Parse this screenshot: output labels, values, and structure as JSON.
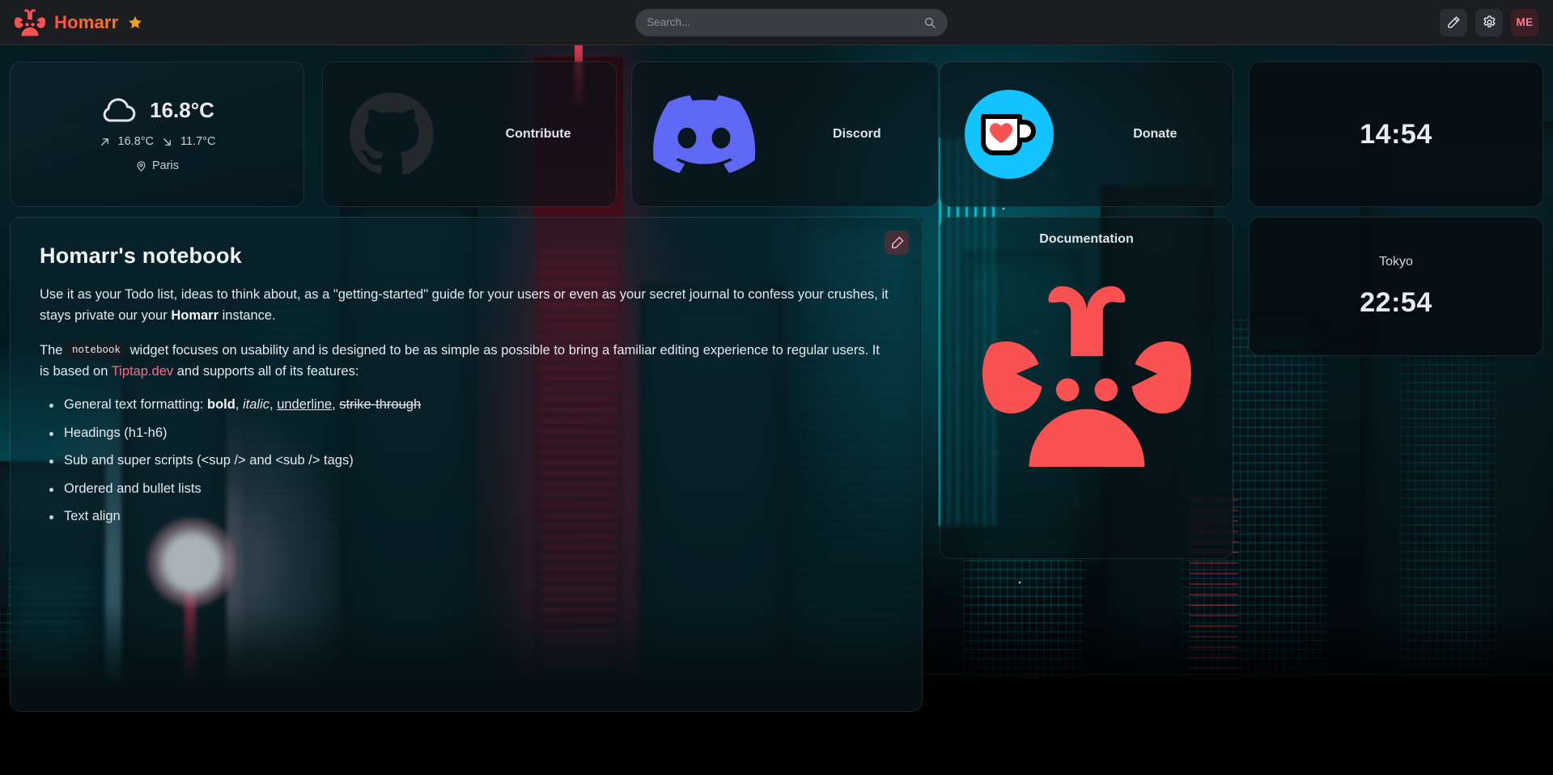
{
  "header": {
    "brand_name": "Homarr",
    "brand_logo_icon": "homarr-crab-logo",
    "brand_star_icon": "star-icon",
    "search": {
      "placeholder": "Search...",
      "value": "",
      "icon": "search-icon"
    },
    "edit_button_icon": "edit-pencil-icon",
    "settings_button_icon": "gear-icon",
    "avatar_initials": "ME"
  },
  "weather": {
    "condition_icon": "cloud-icon",
    "temperature": "16.8°C",
    "max_icon": "arrow-up-right-icon",
    "max_temp": "16.8°C",
    "min_icon": "arrow-down-right-icon",
    "min_temp": "11.7°C",
    "location_icon": "map-pin-icon",
    "location": "Paris"
  },
  "tiles": [
    {
      "id": "contribute",
      "label": "Contribute",
      "icon": "github-icon"
    },
    {
      "id": "discord",
      "label": "Discord",
      "icon": "discord-icon"
    },
    {
      "id": "donate",
      "label": "Donate",
      "icon": "kofi-cup-heart-icon"
    },
    {
      "id": "docs",
      "label": "Documentation",
      "icon": "homarr-crab-logo"
    }
  ],
  "clocks": [
    {
      "id": "local",
      "city": "",
      "time": "14:54"
    },
    {
      "id": "tokyo",
      "city": "Tokyo",
      "time": "22:54"
    }
  ],
  "notebook": {
    "title": "Homarr's notebook",
    "edit_icon": "edit-square-pencil-icon",
    "p1_a": "Use it as your Todo list, ideas to think about, as a \"getting-started\" guide for your users or even as your secret journal to confess your crushes, it stays private our your ",
    "p1_bold": "Homarr",
    "p1_b": " instance.",
    "p2_a": "The ",
    "p2_code": "notebook",
    "p2_b": " widget focuses on usability and is designed to be as simple as possible to bring a familiar editing experience to regular users. It is based on ",
    "p2_link": "Tiptap.dev",
    "p2_c": " and supports all of its features:",
    "features": [
      {
        "prefix": "General text formatting: ",
        "bold": "bold",
        "sep1": ", ",
        "italic": "italic",
        "sep2": ", ",
        "underline": "underline",
        "sep3": ", ",
        "strike": "strike-through"
      },
      {
        "prefix": "Headings (h1-h6)"
      },
      {
        "prefix": "Sub and super scripts (<sup /> and <sub /> tags)"
      },
      {
        "prefix": "Ordered and bullet lists"
      },
      {
        "prefix": "Text align"
      }
    ]
  },
  "colors": {
    "brand_red": "#fa5252",
    "brand_orange": "#fd7e14",
    "discord_blurple": "#5865f2",
    "kofi_blue": "#13c3ff",
    "link_pink": "#ff6b81",
    "header_bg": "#1b1d21"
  }
}
